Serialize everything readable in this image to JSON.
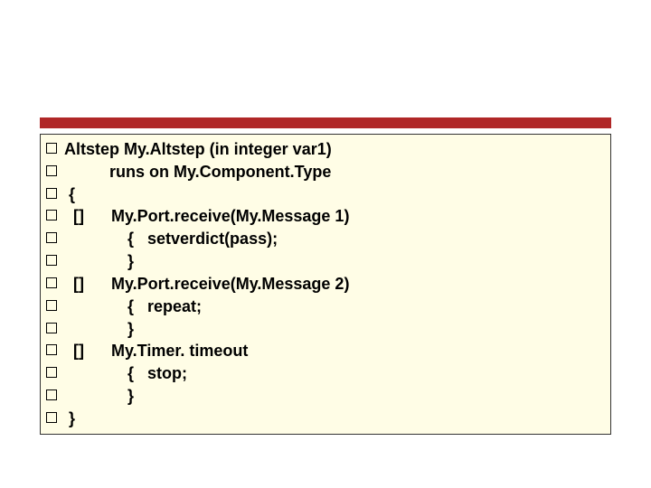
{
  "code": {
    "lines": [
      "Altstep My.Altstep (in integer var1)",
      "          runs on My.Component.Type",
      " {",
      "  []      My.Port.receive(My.Message 1)",
      "              {   setverdict(pass);",
      "              }",
      "  []      My.Port.receive(My.Message 2)",
      "              {   repeat;",
      "              }",
      "  []      My.Timer. timeout",
      "              {   stop;",
      "              }",
      " }"
    ]
  },
  "colors": {
    "accent": "#b02727",
    "box_bg": "#fffde6"
  }
}
